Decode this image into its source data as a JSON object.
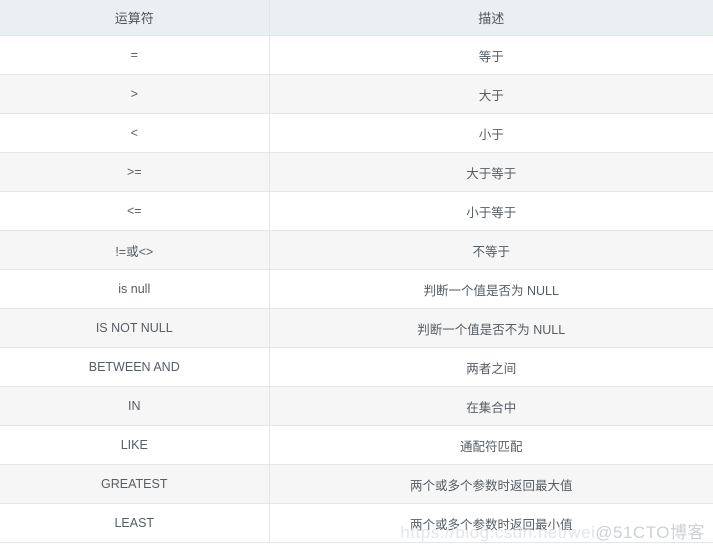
{
  "table": {
    "headers": {
      "operator": "运算符",
      "description": "描述"
    },
    "rows": [
      {
        "operator": "=",
        "description": "等于"
      },
      {
        "operator": ">",
        "description": "大于"
      },
      {
        "operator": "<",
        "description": "小于"
      },
      {
        "operator": ">=",
        "description": "大于等于"
      },
      {
        "operator": "<=",
        "description": "小于等于"
      },
      {
        "operator": "!=或<>",
        "description": "不等于"
      },
      {
        "operator": "is null",
        "description": "判断一个值是否为 NULL"
      },
      {
        "operator": "IS NOT NULL",
        "description": "判断一个值是否不为 NULL"
      },
      {
        "operator": "BETWEEN AND",
        "description": "两者之间"
      },
      {
        "operator": "IN",
        "description": "在集合中"
      },
      {
        "operator": "LIKE",
        "description": "通配符匹配"
      },
      {
        "operator": "GREATEST",
        "description": "两个或多个参数时返回最大值"
      },
      {
        "operator": "LEAST",
        "description": "两个或多个参数时返回最小值"
      }
    ]
  },
  "watermark": {
    "url": "https://blog.csdn.net/wei",
    "handle": "@51CTO博客"
  },
  "colors": {
    "header_background": "#eaeff2",
    "row_odd_background": "#ffffff",
    "row_even_background": "#f6f6f6",
    "border": "#e3e6e8",
    "text": "#565d63",
    "watermark_text": "#c9ccd0"
  }
}
